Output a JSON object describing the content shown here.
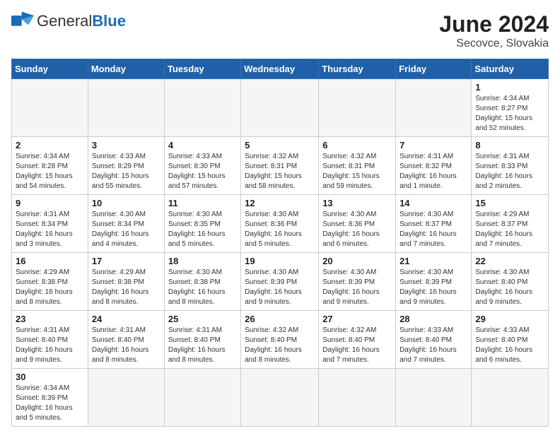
{
  "header": {
    "logo_general": "General",
    "logo_blue": "Blue",
    "month_year": "June 2024",
    "location": "Secovce, Slovakia"
  },
  "days_of_week": [
    "Sunday",
    "Monday",
    "Tuesday",
    "Wednesday",
    "Thursday",
    "Friday",
    "Saturday"
  ],
  "weeks": [
    [
      {
        "day": null,
        "info": null
      },
      {
        "day": null,
        "info": null
      },
      {
        "day": null,
        "info": null
      },
      {
        "day": null,
        "info": null
      },
      {
        "day": null,
        "info": null
      },
      {
        "day": null,
        "info": null
      },
      {
        "day": "1",
        "info": "Sunrise: 4:34 AM\nSunset: 8:27 PM\nDaylight: 15 hours\nand 52 minutes."
      }
    ],
    [
      {
        "day": "2",
        "info": "Sunrise: 4:34 AM\nSunset: 8:28 PM\nDaylight: 15 hours\nand 54 minutes."
      },
      {
        "day": "3",
        "info": "Sunrise: 4:33 AM\nSunset: 8:29 PM\nDaylight: 15 hours\nand 55 minutes."
      },
      {
        "day": "4",
        "info": "Sunrise: 4:33 AM\nSunset: 8:30 PM\nDaylight: 15 hours\nand 57 minutes."
      },
      {
        "day": "5",
        "info": "Sunrise: 4:32 AM\nSunset: 8:31 PM\nDaylight: 15 hours\nand 58 minutes."
      },
      {
        "day": "6",
        "info": "Sunrise: 4:32 AM\nSunset: 8:31 PM\nDaylight: 15 hours\nand 59 minutes."
      },
      {
        "day": "7",
        "info": "Sunrise: 4:31 AM\nSunset: 8:32 PM\nDaylight: 16 hours\nand 1 minute."
      },
      {
        "day": "8",
        "info": "Sunrise: 4:31 AM\nSunset: 8:33 PM\nDaylight: 16 hours\nand 2 minutes."
      }
    ],
    [
      {
        "day": "9",
        "info": "Sunrise: 4:31 AM\nSunset: 8:34 PM\nDaylight: 16 hours\nand 3 minutes."
      },
      {
        "day": "10",
        "info": "Sunrise: 4:30 AM\nSunset: 8:34 PM\nDaylight: 16 hours\nand 4 minutes."
      },
      {
        "day": "11",
        "info": "Sunrise: 4:30 AM\nSunset: 8:35 PM\nDaylight: 16 hours\nand 5 minutes."
      },
      {
        "day": "12",
        "info": "Sunrise: 4:30 AM\nSunset: 8:36 PM\nDaylight: 16 hours\nand 5 minutes."
      },
      {
        "day": "13",
        "info": "Sunrise: 4:30 AM\nSunset: 8:36 PM\nDaylight: 16 hours\nand 6 minutes."
      },
      {
        "day": "14",
        "info": "Sunrise: 4:30 AM\nSunset: 8:37 PM\nDaylight: 16 hours\nand 7 minutes."
      },
      {
        "day": "15",
        "info": "Sunrise: 4:29 AM\nSunset: 8:37 PM\nDaylight: 16 hours\nand 7 minutes."
      }
    ],
    [
      {
        "day": "16",
        "info": "Sunrise: 4:29 AM\nSunset: 8:38 PM\nDaylight: 16 hours\nand 8 minutes."
      },
      {
        "day": "17",
        "info": "Sunrise: 4:29 AM\nSunset: 8:38 PM\nDaylight: 16 hours\nand 8 minutes."
      },
      {
        "day": "18",
        "info": "Sunrise: 4:30 AM\nSunset: 8:38 PM\nDaylight: 16 hours\nand 8 minutes."
      },
      {
        "day": "19",
        "info": "Sunrise: 4:30 AM\nSunset: 8:39 PM\nDaylight: 16 hours\nand 9 minutes."
      },
      {
        "day": "20",
        "info": "Sunrise: 4:30 AM\nSunset: 8:39 PM\nDaylight: 16 hours\nand 9 minutes."
      },
      {
        "day": "21",
        "info": "Sunrise: 4:30 AM\nSunset: 8:39 PM\nDaylight: 16 hours\nand 9 minutes."
      },
      {
        "day": "22",
        "info": "Sunrise: 4:30 AM\nSunset: 8:40 PM\nDaylight: 16 hours\nand 9 minutes."
      }
    ],
    [
      {
        "day": "23",
        "info": "Sunrise: 4:31 AM\nSunset: 8:40 PM\nDaylight: 16 hours\nand 9 minutes."
      },
      {
        "day": "24",
        "info": "Sunrise: 4:31 AM\nSunset: 8:40 PM\nDaylight: 16 hours\nand 8 minutes."
      },
      {
        "day": "25",
        "info": "Sunrise: 4:31 AM\nSunset: 8:40 PM\nDaylight: 16 hours\nand 8 minutes."
      },
      {
        "day": "26",
        "info": "Sunrise: 4:32 AM\nSunset: 8:40 PM\nDaylight: 16 hours\nand 8 minutes."
      },
      {
        "day": "27",
        "info": "Sunrise: 4:32 AM\nSunset: 8:40 PM\nDaylight: 16 hours\nand 7 minutes."
      },
      {
        "day": "28",
        "info": "Sunrise: 4:33 AM\nSunset: 8:40 PM\nDaylight: 16 hours\nand 7 minutes."
      },
      {
        "day": "29",
        "info": "Sunrise: 4:33 AM\nSunset: 8:40 PM\nDaylight: 16 hours\nand 6 minutes."
      }
    ],
    [
      {
        "day": "30",
        "info": "Sunrise: 4:34 AM\nSunset: 8:39 PM\nDaylight: 16 hours\nand 5 minutes."
      },
      {
        "day": null,
        "info": null
      },
      {
        "day": null,
        "info": null
      },
      {
        "day": null,
        "info": null
      },
      {
        "day": null,
        "info": null
      },
      {
        "day": null,
        "info": null
      },
      {
        "day": null,
        "info": null
      }
    ]
  ]
}
